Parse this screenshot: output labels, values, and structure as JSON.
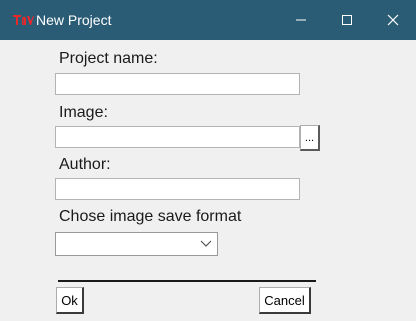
{
  "window": {
    "title": "New Project",
    "icon": "app-logo-icon"
  },
  "colors": {
    "titlebar": "#2b5c76",
    "title_text": "#ffffff",
    "app_icon": "#e8282b",
    "window_bg": "#f0f0f0"
  },
  "form": {
    "project_name_label": "Project name:",
    "project_name_value": "",
    "image_label": "Image:",
    "image_value": "",
    "browse_label": "...",
    "author_label": "Author:",
    "author_value": "",
    "format_label": "Chose image save format",
    "format_selected": ""
  },
  "actions": {
    "ok_label": "Ok",
    "cancel_label": "Cancel"
  }
}
